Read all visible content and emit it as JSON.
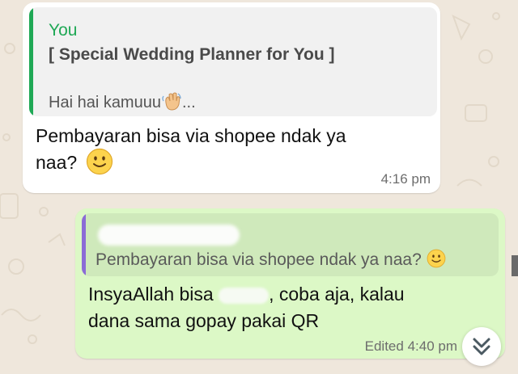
{
  "incoming": {
    "quote_author": "You",
    "quote_title": "[ Special Wedding Planner for You ]",
    "quote_snippet": "Hai hai kamuuu",
    "quote_ellipsis": "...",
    "text_line1": "Pembayaran bisa via shopee ndak ya",
    "text_line2": "naa?",
    "time": "4:16 pm"
  },
  "outgoing": {
    "quote_text": "Pembayaran bisa via shopee ndak ya naa?",
    "text_line1_a": "InsyaAllah bisa",
    "text_line1_b": ", coba aja, kalau",
    "text_line2": "dana sama gopay pakai QR",
    "time": "Edited 4:40 pm"
  },
  "icons": {
    "emoji_1": "slightly-smiling-face-icon",
    "emoji_2": "waving-hand-icon",
    "scroll": "chevrons-down-icon"
  },
  "colors": {
    "incoming_bubble": "#ffffff",
    "outgoing_bubble": "#dcf8c6",
    "quote_bar_self": "#1fa855",
    "quote_bar_other": "#8b6bd6"
  }
}
